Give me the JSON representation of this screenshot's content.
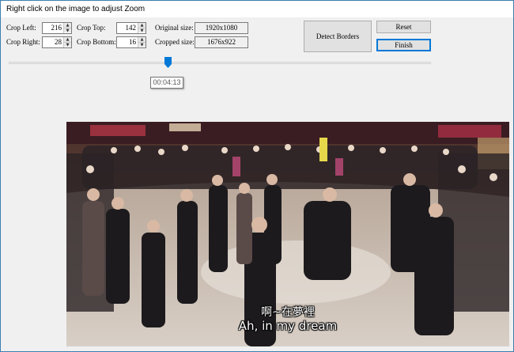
{
  "window": {
    "title": "Right click on the image to adjust Zoom"
  },
  "crop": {
    "left_label": "Crop Left:",
    "left_value": "216",
    "right_label": "Crop Right:",
    "right_value": "28",
    "top_label": "Crop Top:",
    "top_value": "142",
    "bottom_label": "Crop Bottom:",
    "bottom_value": "16"
  },
  "sizes": {
    "original_label": "Original size:",
    "original_value": "1920x1080",
    "cropped_label": "Cropped size:",
    "cropped_value": "1676x922"
  },
  "buttons": {
    "detect": "Detect Borders",
    "reset": "Reset",
    "finish": "Finish"
  },
  "slider": {
    "time_tooltip": "00:04:13",
    "position_fraction": 0.383
  },
  "video": {
    "subtitle_line1": "啊~在夢裡",
    "subtitle_line2": "Ah, in my dream"
  },
  "icons": {
    "spin_up": "spin-up-arrow-icon",
    "spin_down": "spin-down-arrow-icon",
    "slider_thumb": "slider-thumb-icon"
  },
  "colors": {
    "window_border": "#3c7fb1",
    "focus_blue": "#0078d7",
    "slider_thumb": "#0078d7"
  }
}
